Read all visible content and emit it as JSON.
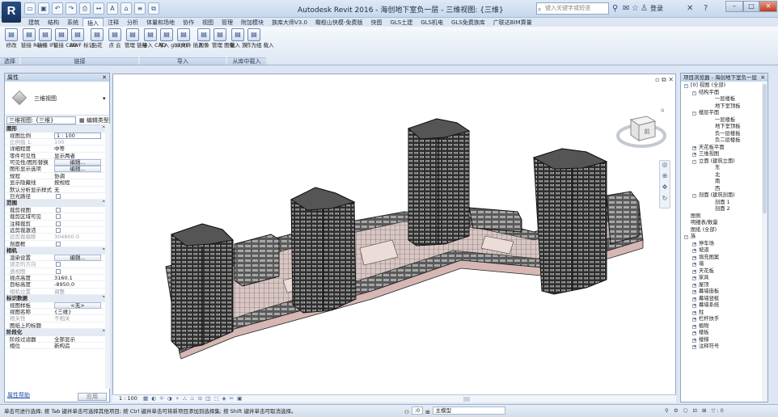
{
  "title_bar": {
    "app_logo": "R",
    "title": "Autodesk Revit 2016 -   海创地下室负一层 - 三维视图: {三维}",
    "search_placeholder": "键入关键字或短语",
    "login": "登录",
    "help": "?"
  },
  "tabs": [
    "建筑",
    "结构",
    "系统",
    "插入",
    "注释",
    "分析",
    "体量和场地",
    "协作",
    "视图",
    "管理",
    "附加模块",
    "族库大师V3.0",
    "橄榄山快模-免费版",
    "快图",
    "GLS土建",
    "GLS机电",
    "GLS免费族库",
    "广联达BIM算量"
  ],
  "active_tab": "插入",
  "ribbon": {
    "buttons": [
      {
        "label": "修改",
        "icon": "modify-icon"
      },
      {
        "label": "链接 Revit",
        "icon": "link-revit-icon"
      },
      {
        "label": "链接 IFC",
        "icon": "link-ifc-icon"
      },
      {
        "label": "链接 CAD",
        "icon": "link-cad-icon"
      },
      {
        "label": "DWF 标记",
        "icon": "dwf-icon"
      },
      {
        "label": "贴花",
        "icon": "decal-icon"
      },
      {
        "label": "点 云",
        "icon": "point-cloud-icon"
      },
      {
        "label": "管理 链接",
        "icon": "manage-links-icon"
      },
      {
        "label": "导入 CAD",
        "icon": "import-cad-icon"
      },
      {
        "label": "导入 gbXML",
        "icon": "import-gbxml-icon"
      },
      {
        "label": "从文件 插入",
        "icon": "insert-file-icon"
      },
      {
        "label": "图像",
        "icon": "image-icon"
      },
      {
        "label": "管理 图像",
        "icon": "manage-images-icon"
      },
      {
        "label": "载入 族",
        "icon": "load-family-icon"
      },
      {
        "label": "作为组 载入",
        "icon": "load-group-icon"
      }
    ],
    "panels": [
      "选择",
      "链接",
      "导入",
      "从库中载入"
    ]
  },
  "properties": {
    "title": "属性",
    "type_name": "三维视图",
    "type_selector": "三维视图: {三维}",
    "edit_type": "编辑类型",
    "groups": [
      {
        "name": "图形",
        "rows": [
          {
            "k": "视图比例",
            "v": "1 : 100",
            "style": "input"
          },
          {
            "k": "比例值 1:",
            "v": "100",
            "style": "dim"
          },
          {
            "k": "详细程度",
            "v": "中等"
          },
          {
            "k": "零件可见性",
            "v": "显示两者"
          },
          {
            "k": "可见性/图形替换",
            "v": "编辑...",
            "style": "button"
          },
          {
            "k": "图形显示选项",
            "v": "编辑...",
            "style": "button"
          },
          {
            "k": "规程",
            "v": "协调"
          },
          {
            "k": "显示隐藏线",
            "v": "按规程"
          },
          {
            "k": "默认分析显示样式",
            "v": "无"
          },
          {
            "k": "日光路径",
            "v": "",
            "style": "check"
          }
        ]
      },
      {
        "name": "范围",
        "rows": [
          {
            "k": "裁剪视图",
            "v": "",
            "style": "check"
          },
          {
            "k": "裁剪区域可见",
            "v": "",
            "style": "check"
          },
          {
            "k": "注释裁剪",
            "v": "",
            "style": "check"
          },
          {
            "k": "远剪裁激活",
            "v": "",
            "style": "check"
          },
          {
            "k": "远剪裁偏移",
            "v": "304800.0",
            "style": "dim"
          },
          {
            "k": "剖面框",
            "v": "",
            "style": "check"
          }
        ]
      },
      {
        "name": "相机",
        "rows": [
          {
            "k": "渲染设置",
            "v": "编辑...",
            "style": "button"
          },
          {
            "k": "锁定的方向",
            "v": "",
            "style": "checkdim"
          },
          {
            "k": "透视图",
            "v": "",
            "style": "checkdim"
          },
          {
            "k": "视点高度",
            "v": "3160.1"
          },
          {
            "k": "目标高度",
            "v": "-8950.0"
          },
          {
            "k": "相机位置",
            "v": "调整",
            "style": "dim"
          }
        ]
      },
      {
        "name": "标识数据",
        "rows": [
          {
            "k": "视图样板",
            "v": "<无>",
            "style": "button"
          },
          {
            "k": "视图名称",
            "v": "{三维}"
          },
          {
            "k": "相关性",
            "v": "不相关",
            "style": "dim"
          },
          {
            "k": "图纸上的标题",
            "v": ""
          }
        ]
      },
      {
        "name": "阶段化",
        "rows": [
          {
            "k": "阶段过滤器",
            "v": "全部显示"
          },
          {
            "k": "相位",
            "v": "新构造"
          }
        ]
      }
    ],
    "help_link": "属性帮助",
    "apply": "应用"
  },
  "viewcube": {
    "face_label": "前"
  },
  "view_control": {
    "scale": "1 : 100"
  },
  "browser": {
    "title": "项目浏览器 - 海创地下室负一层",
    "tree": [
      {
        "d": 0,
        "t": "[0] 视图 (全部)",
        "ex": "-"
      },
      {
        "d": 1,
        "t": "结构平面",
        "ex": "-"
      },
      {
        "d": 3,
        "t": "一层楼板"
      },
      {
        "d": 3,
        "t": "地下室顶板"
      },
      {
        "d": 1,
        "t": "楼层平面",
        "ex": "-"
      },
      {
        "d": 3,
        "t": "一层楼板"
      },
      {
        "d": 3,
        "t": "地下室顶板"
      },
      {
        "d": 3,
        "t": "负一层楼板"
      },
      {
        "d": 3,
        "t": "负二层楼板"
      },
      {
        "d": 1,
        "t": "天花板平面",
        "ex": "+"
      },
      {
        "d": 1,
        "t": "三维视图",
        "ex": "+"
      },
      {
        "d": 1,
        "t": "立面 (建筑立面)",
        "ex": "-"
      },
      {
        "d": 3,
        "t": "东"
      },
      {
        "d": 3,
        "t": "北"
      },
      {
        "d": 3,
        "t": "南"
      },
      {
        "d": 3,
        "t": "西"
      },
      {
        "d": 1,
        "t": "剖面 (建筑剖面)",
        "ex": "-"
      },
      {
        "d": 3,
        "t": "剖面 1"
      },
      {
        "d": 3,
        "t": "剖面 2"
      },
      {
        "d": 0,
        "t": "图例"
      },
      {
        "d": 0,
        "t": "明细表/数量"
      },
      {
        "d": 0,
        "t": "图纸 (全部)"
      },
      {
        "d": 0,
        "t": "族",
        "ex": "-"
      },
      {
        "d": 1,
        "t": "停车场",
        "ex": "+"
      },
      {
        "d": 1,
        "t": "坡道",
        "ex": "+"
      },
      {
        "d": 1,
        "t": "填充图案",
        "ex": "+"
      },
      {
        "d": 1,
        "t": "墙",
        "ex": "+"
      },
      {
        "d": 1,
        "t": "天花板",
        "ex": "+"
      },
      {
        "d": 1,
        "t": "家具",
        "ex": "+"
      },
      {
        "d": 1,
        "t": "屋顶",
        "ex": "+"
      },
      {
        "d": 1,
        "t": "幕墙嵌板",
        "ex": "+"
      },
      {
        "d": 1,
        "t": "幕墙竖梃",
        "ex": "+"
      },
      {
        "d": 1,
        "t": "幕墙系统",
        "ex": "+"
      },
      {
        "d": 1,
        "t": "柱",
        "ex": "+"
      },
      {
        "d": 1,
        "t": "栏杆扶手",
        "ex": "+"
      },
      {
        "d": 1,
        "t": "植物",
        "ex": "+"
      },
      {
        "d": 1,
        "t": "楼板",
        "ex": "+"
      },
      {
        "d": 1,
        "t": "楼梯",
        "ex": "+"
      },
      {
        "d": 1,
        "t": "注释符号",
        "ex": "+"
      }
    ]
  },
  "status": {
    "text": "单击可进行选择; 按 Tab 键并单击可选择其他项目; 按 Ctrl 键并单击可将新项目添加到选择集; 按 Shift 键并单击可取消选择。",
    "coord": ":0",
    "model": "主模型"
  }
}
